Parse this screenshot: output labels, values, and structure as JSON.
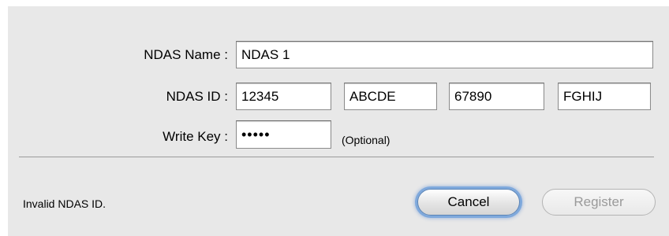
{
  "form": {
    "name_label": "NDAS Name :",
    "name_value": "NDAS 1",
    "id_label": "NDAS ID :",
    "id_parts": [
      "12345",
      "ABCDE",
      "67890",
      "FGHIJ"
    ],
    "write_key_label": "Write Key :",
    "write_key_value": "•••••",
    "write_key_hint": "(Optional)"
  },
  "footer": {
    "status_text": "Invalid NDAS ID.",
    "cancel_label": "Cancel",
    "register_label": "Register",
    "register_enabled": false,
    "cancel_focused": true
  },
  "colors": {
    "dialog_background": "#e8e8e8",
    "focus_ring": "#7fa9dc",
    "disabled_text": "#9a9a9a"
  }
}
